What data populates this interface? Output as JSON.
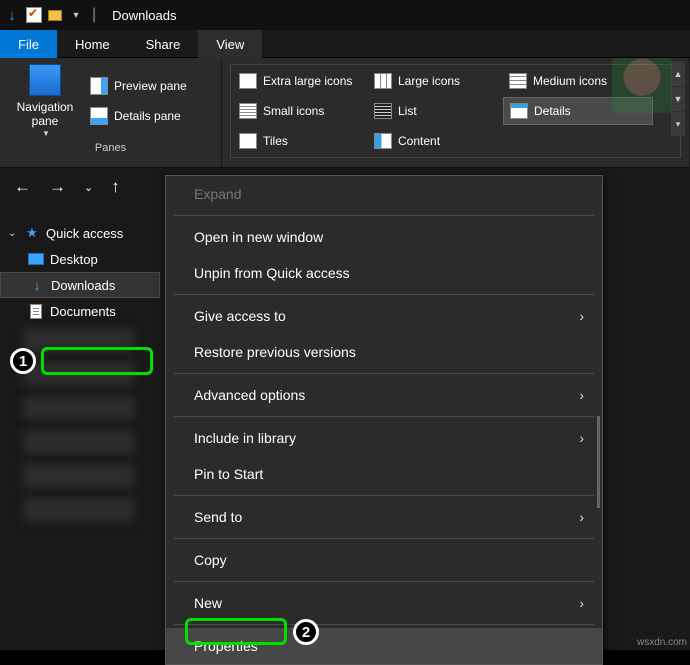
{
  "titlebar": {
    "title": "Downloads"
  },
  "tabs": {
    "file": "File",
    "home": "Home",
    "share": "Share",
    "view": "View"
  },
  "ribbon": {
    "panes_label": "Panes",
    "navigation_pane": "Navigation pane",
    "preview_pane": "Preview pane",
    "details_pane": "Details pane",
    "layout": {
      "extra_large": "Extra large icons",
      "large": "Large icons",
      "medium": "Medium icons",
      "small": "Small icons",
      "list": "List",
      "details": "Details",
      "tiles": "Tiles",
      "content": "Content"
    }
  },
  "tree": {
    "quick_access": "Quick access",
    "desktop": "Desktop",
    "downloads": "Downloads",
    "documents": "Documents"
  },
  "context_menu": {
    "expand": "Expand",
    "open_new_window": "Open in new window",
    "unpin_quick_access": "Unpin from Quick access",
    "give_access_to": "Give access to",
    "restore_versions": "Restore previous versions",
    "advanced_options": "Advanced options",
    "include_in_library": "Include in library",
    "pin_to_start": "Pin to Start",
    "send_to": "Send to",
    "copy": "Copy",
    "new": "New",
    "properties": "Properties"
  },
  "annotations": {
    "badge1": "1",
    "badge2": "2"
  },
  "watermark": "wsxdn.com"
}
